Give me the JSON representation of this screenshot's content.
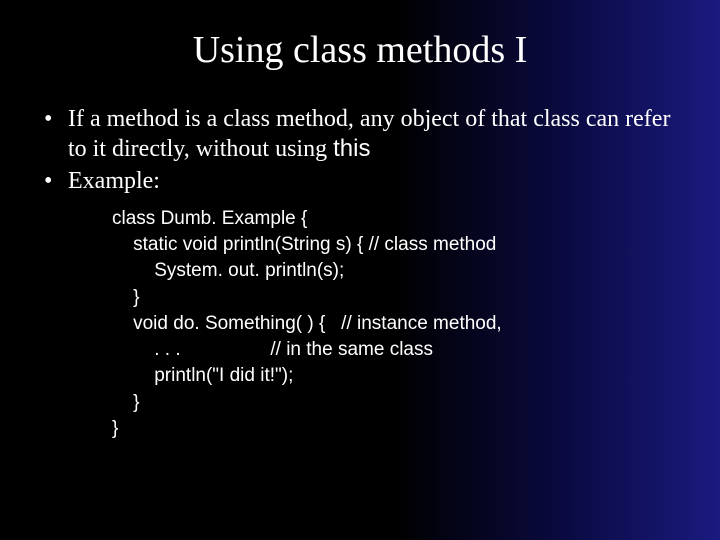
{
  "title": "Using class methods I",
  "bullets": {
    "b1_part1": "If a method is a class method, any object of that class can refer to it directly, without using ",
    "b1_this": "this",
    "b2": "Example:"
  },
  "code": {
    "l1": "class Dumb. Example {",
    "l2": "    static void println(String s) { // class method",
    "l3": "        System. out. println(s);",
    "l4": "    }",
    "l5": "    void do. Something( ) {   // instance method,",
    "l6": "        . . .                 // in the same class",
    "l7": "        println(\"I did it!\");",
    "l8": "    }",
    "l9": "}"
  }
}
